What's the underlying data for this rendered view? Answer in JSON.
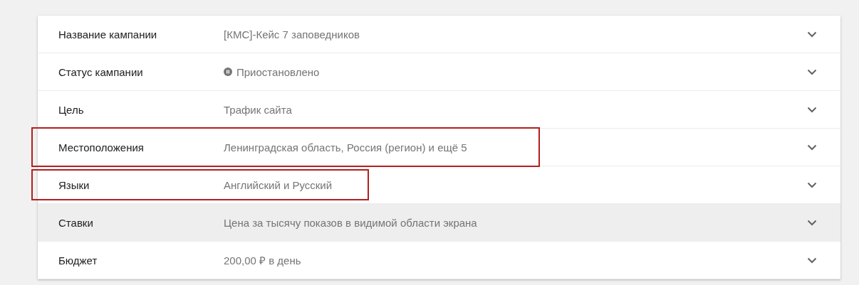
{
  "rows": [
    {
      "kind": "text",
      "label": "Название кампании",
      "value": "[КМС]-Кейс 7 заповедников",
      "highlighted": false,
      "hovered": false
    },
    {
      "kind": "status",
      "label": "Статус кампании",
      "value": "Приостановлено",
      "highlighted": false,
      "hovered": false
    },
    {
      "kind": "text",
      "label": "Цель",
      "value": "Трафик сайта",
      "highlighted": false,
      "hovered": false
    },
    {
      "kind": "text",
      "label": "Местоположения",
      "value": "Ленинградская область, Россия (регион) и ещё 5",
      "highlighted": true,
      "hovered": false
    },
    {
      "kind": "text",
      "label": "Языки",
      "value": "Английский и Русский",
      "highlighted": true,
      "hovered": false
    },
    {
      "kind": "text",
      "label": "Ставки",
      "value": "Цена за тысячу показов в видимой области экрана",
      "highlighted": false,
      "hovered": true
    },
    {
      "kind": "text",
      "label": "Бюджет",
      "value": "200,00 ₽ в день",
      "highlighted": false,
      "hovered": false
    }
  ]
}
